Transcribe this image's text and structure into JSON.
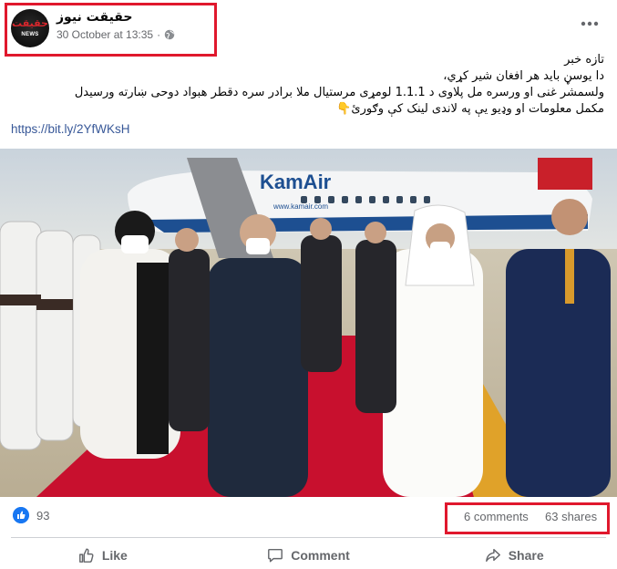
{
  "post": {
    "page_name": "حقیقت نیوز",
    "avatar_logo_text": "حقيقت",
    "avatar_logo_sub": "NEWS",
    "timestamp": "30 October at 13:35",
    "separator": "·",
    "text_lines": [
      "تازه خبر",
      "دا یوسڼ باید هر افغان شیر کړي،",
      "ولسمشر غنی او ورسره مل پلاوی د 1.1.1 لومړی مرستیال ملا برادر سره دقطر هبواد دوحی ښارته ورسیدل",
      "مکمل معلومات او وډیو  یې په لاندی لینک کې وګورئ👇"
    ],
    "link": "https://bit.ly/2YfWKsH"
  },
  "photo": {
    "aircraft_text": "KamAir",
    "aircraft_url": "www.kamair.com"
  },
  "stats": {
    "like_count": "93",
    "comments": "6 comments",
    "shares": "63 shares"
  },
  "actions": {
    "like": "Like",
    "comment": "Comment",
    "share": "Share"
  },
  "colors": {
    "facebook_blue": "#1877f2",
    "link": "#385898",
    "highlight_red": "#e0182d",
    "secondary_text": "#65676b",
    "carpet_red": "#c8102e"
  },
  "icons": [
    "globe-icon",
    "more-options-icon",
    "like-reaction-icon",
    "thumbs-up-icon",
    "comment-icon",
    "share-icon"
  ]
}
